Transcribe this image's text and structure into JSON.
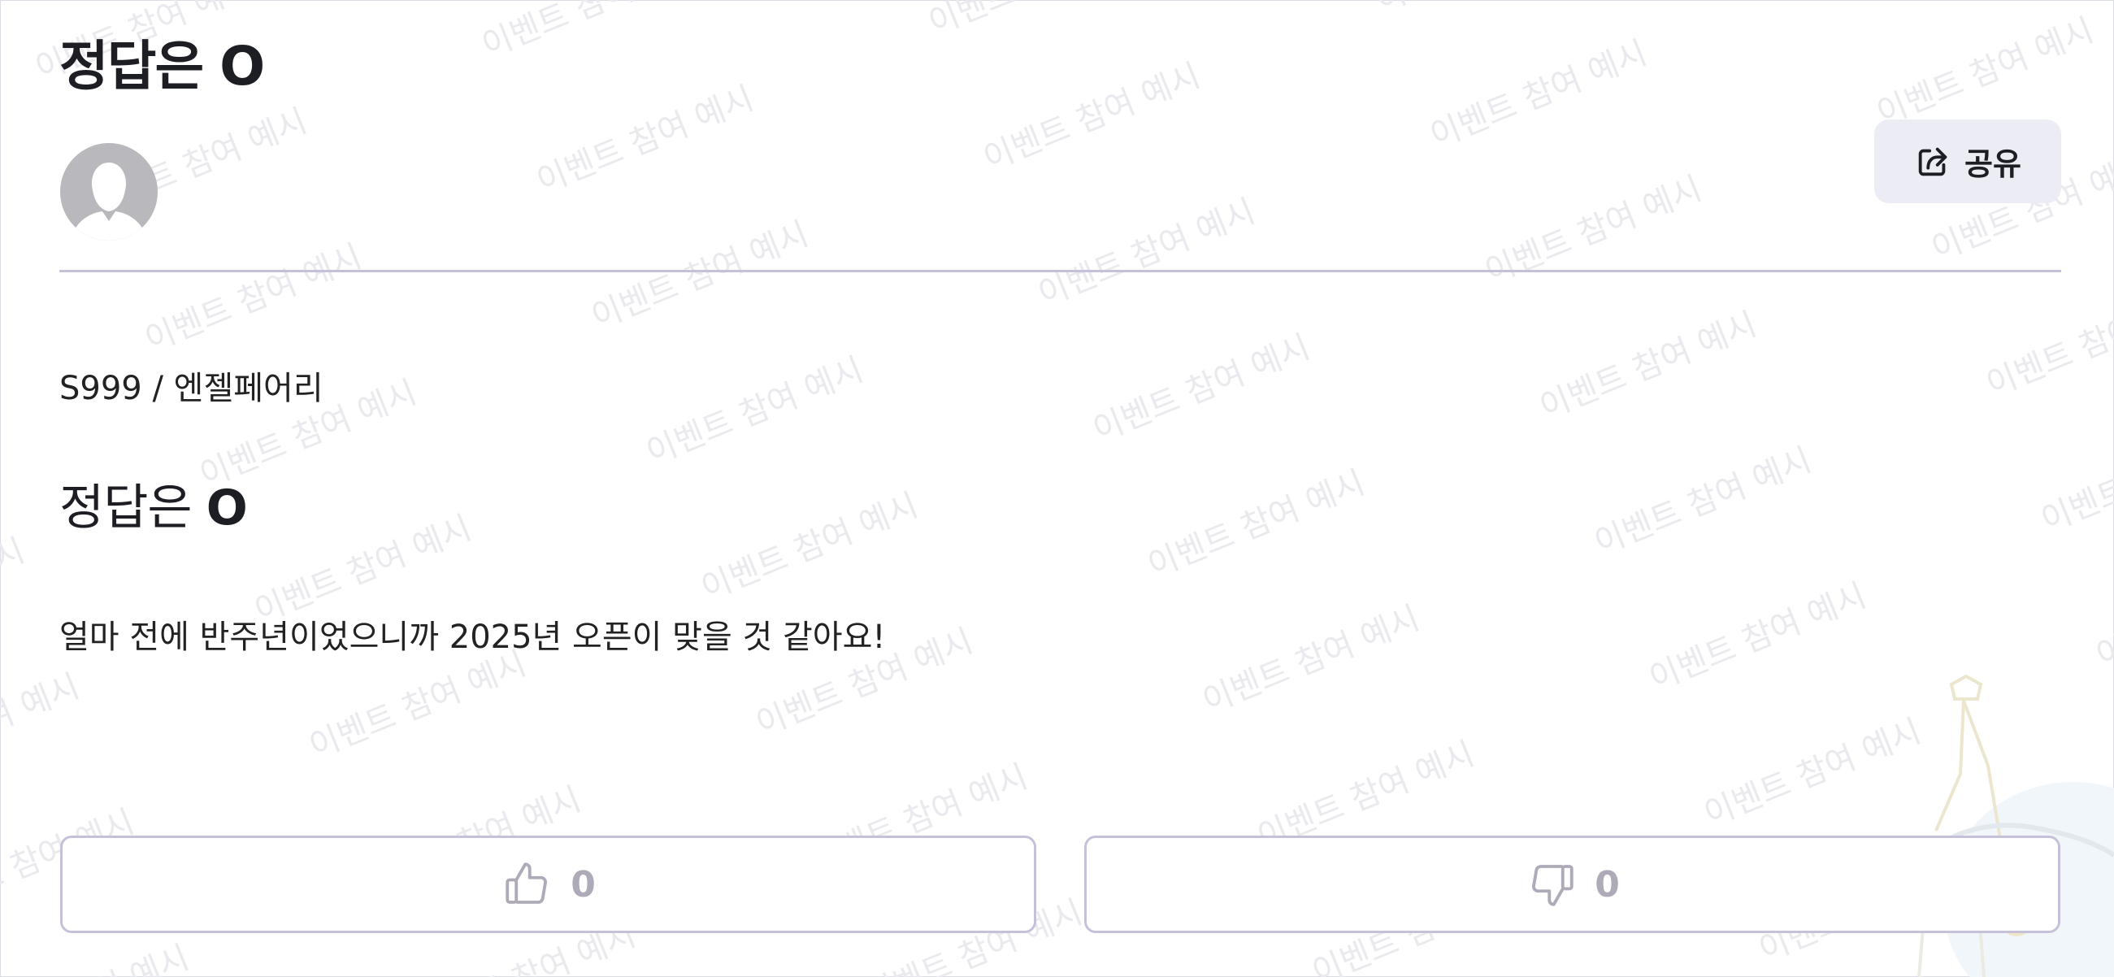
{
  "watermark_text": "이벤트 참여 예시",
  "header": {
    "title": "정답은 O",
    "share_label": "공유"
  },
  "post": {
    "meta": "S999 / 엔젤페어리",
    "title_prefix": "정답은 ",
    "title_answer": "O",
    "body": "얼마 전에 반주년이었으니까 2025년 오픈이 맞을 것 같아요!"
  },
  "votes": {
    "like_count": "0",
    "dislike_count": "0"
  },
  "colors": {
    "accent_border": "#c6c1db",
    "share_bg": "#ececf5",
    "muted": "#aeaab8",
    "avatar": "#b9b9bd"
  }
}
